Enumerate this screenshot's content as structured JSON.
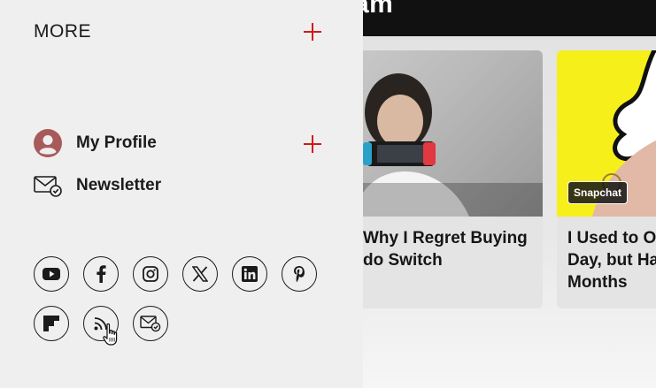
{
  "background": {
    "header_title": "am",
    "cards": [
      {
        "title": "Why I Regret Buying\ndo Switch",
        "badge": ""
      },
      {
        "title": "I Used to Op\nDay, but Ha\nMonths",
        "badge": "Snapchat"
      }
    ]
  },
  "menu": {
    "more_label": "MORE",
    "items": [
      {
        "label": "My Profile",
        "icon": "user-icon"
      },
      {
        "label": "Newsletter",
        "icon": "newsletter-icon"
      }
    ],
    "socials": [
      "youtube-icon",
      "facebook-icon",
      "instagram-icon",
      "x-icon",
      "linkedin-icon",
      "pinterest-icon",
      "flipboard-icon",
      "rss-icon",
      "newsletter-icon"
    ]
  },
  "colors": {
    "accent": "#d11a1a",
    "avatar": "#a85a5a",
    "text": "#1b1b1b",
    "panel": "#f0efef"
  }
}
